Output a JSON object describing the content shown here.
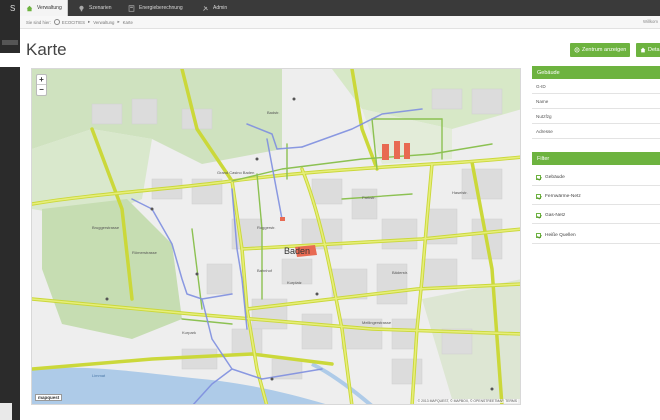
{
  "sidebar": {
    "logo": "S"
  },
  "nav": {
    "tabs": [
      {
        "label": "Verwaltung",
        "icon": "home-icon",
        "active": true
      },
      {
        "label": "Szenarien",
        "icon": "scenario-icon",
        "active": false
      },
      {
        "label": "Energieberechnung",
        "icon": "calculator-icon",
        "active": false
      },
      {
        "label": "Admin",
        "icon": "tools-icon",
        "active": false
      }
    ]
  },
  "breadcrumb": {
    "prefix": "Sie sind hier:",
    "items": [
      "ECOCITIES",
      "Verwaltung",
      "Karte"
    ],
    "right": "Willkom"
  },
  "page": {
    "title": "Karte"
  },
  "actions": {
    "center_label": "Zentrum anzeigen",
    "details_label": "Deta"
  },
  "map": {
    "zoom_in": "+",
    "zoom_out": "−",
    "provider_logo": "mapquest",
    "attribution": "© 2013 MAPQUEST, © MAPBOX, © OPENSTREETMAP, TERMS",
    "city_label": "Baden",
    "labels": [
      "Baden",
      "Roggerstr.",
      "Römerstrasse",
      "Mellingerstrasse",
      "Grand Casino Baden",
      "Bahnhof",
      "Kurpark",
      "Parkstr.",
      "Bruggerstrasse",
      "Haselstr.",
      "Limmat",
      "Kurplatz",
      "Badstr.",
      "Bäderstr."
    ],
    "colors": {
      "background": "#eeeeee",
      "park": "#c8dfb5",
      "road_major": "#d4e157",
      "road_outline": "#c3cf3a",
      "road_green": "#8cc152",
      "network_blue": "#7f8fe0",
      "building_red": "#e86a52",
      "water": "#a8c8e8"
    }
  },
  "panels": {
    "building": {
      "title": "Gebäude",
      "fields": [
        "G-ID",
        "Name",
        "Nutzfzg",
        "Adresse"
      ]
    },
    "filter": {
      "title": "Filter",
      "items": [
        "Gebäude",
        "Fernwärme-Netz",
        "Gas-Netz",
        "Heiße Quellen"
      ]
    }
  },
  "colors": {
    "accent": "#6db33f",
    "topbar": "#3a3a3a",
    "sidebar": "#2b2b2b"
  }
}
